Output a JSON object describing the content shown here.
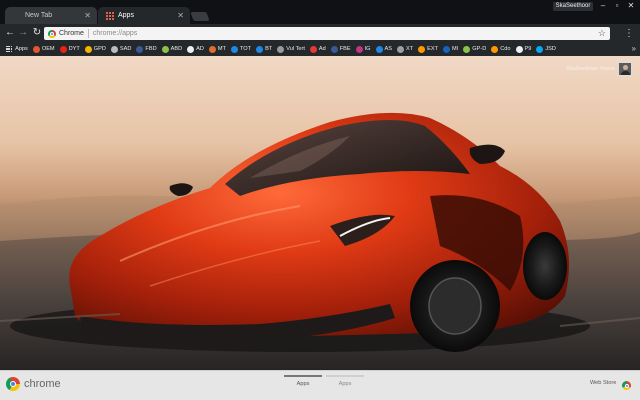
{
  "window": {
    "profile_name": "SkaSeethoor"
  },
  "tabs": [
    {
      "title": "New Tab",
      "active": false
    },
    {
      "title": "Apps",
      "active": true
    }
  ],
  "omnibox": {
    "scheme_label": "Chrome",
    "url": "chrome://apps"
  },
  "bookmarks": [
    {
      "label": "Apps",
      "icon": "apps-grid-icon",
      "color": "#d6d6d6"
    },
    {
      "label": "OEM",
      "icon": "chrome-icon",
      "color": "#e4572e"
    },
    {
      "label": "DYT",
      "icon": "youtube-icon",
      "color": "#e62117"
    },
    {
      "label": "GPD",
      "icon": "drive-icon",
      "color": "#f4b400"
    },
    {
      "label": "SAD",
      "icon": "share-icon",
      "color": "#bbbbbb"
    },
    {
      "label": "FBD",
      "icon": "facebook-icon",
      "color": "#3b5998"
    },
    {
      "label": "ABD",
      "icon": "android-icon",
      "color": "#8bc34a"
    },
    {
      "label": "AD",
      "icon": "app-icon",
      "color": "#eeeeee"
    },
    {
      "label": "MT",
      "icon": "image-icon",
      "color": "#e06c2e"
    },
    {
      "label": "TOT",
      "icon": "store-icon",
      "color": "#1e88e5"
    },
    {
      "label": "BT",
      "icon": "bt-icon",
      "color": "#1e88e5"
    },
    {
      "label": "Vul Tert",
      "icon": "sparkle-icon",
      "color": "#999999"
    },
    {
      "label": "Ad",
      "icon": "ad-icon",
      "color": "#e53935"
    },
    {
      "label": "FBE",
      "icon": "facebook-icon",
      "color": "#3b5998"
    },
    {
      "label": "IG",
      "icon": "instagram-icon",
      "color": "#c13584"
    },
    {
      "label": "AS",
      "icon": "appstore-icon",
      "color": "#1e88e5"
    },
    {
      "label": "XT",
      "icon": "settings-icon",
      "color": "#9e9e9e"
    },
    {
      "label": "EXT",
      "icon": "extension-icon",
      "color": "#ff9800"
    },
    {
      "label": "MI",
      "icon": "mi-icon",
      "color": "#1565c0"
    },
    {
      "label": "GP-D",
      "icon": "android-icon",
      "color": "#8bc34a"
    },
    {
      "label": "Cdo",
      "icon": "cdo-icon",
      "color": "#ff9800"
    },
    {
      "label": "P9",
      "icon": "doc-icon",
      "color": "#eeeeee"
    },
    {
      "label": "JSD",
      "icon": "play-icon",
      "color": "#03a9f4"
    }
  ],
  "content": {
    "user_name": "SkaSeethoor Veera"
  },
  "bottom_bar": {
    "brand": "chrome",
    "pages": [
      {
        "label": "Apps",
        "active": true
      },
      {
        "label": "Apps",
        "active": false
      }
    ],
    "webstore_label": "Web Store"
  }
}
